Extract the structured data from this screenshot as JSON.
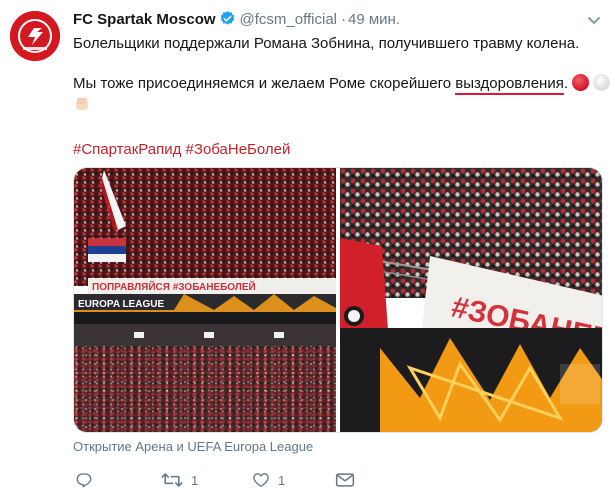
{
  "tweet": {
    "author_name": "FC Spartak Moscow",
    "handle": "@fcsm_official",
    "separator": "·",
    "time": "49 мин.",
    "verified": true,
    "text_line1": "Болельщики поддержали Романа Зобнина, получившего травму колена.",
    "text_line2_before": "Мы тоже присоединяемся и желаем Роме скорейшего ",
    "text_line2_underlined": "выздоровления",
    "text_line2_after": ".",
    "hashtags": [
      "#СпартакРапид",
      "#ЗобаНеБолей"
    ],
    "photo_banner_text": "ПОПРАВЛЯЙСЯ #ЗОБАНЕБОЛЕЙ",
    "photo_sponsor_text": "EUROPA LEAGUE",
    "photo_right_banner": "#ЗОБАНЕБОЛЕ",
    "media_caption": "Открытие Арена и UEFA Europa League",
    "reply_count": "",
    "retweet_count": "1",
    "like_count": "1"
  },
  "colors": {
    "brand_red": "#d41820",
    "hashtag": "#c4232c",
    "verified_blue": "#1da1f2",
    "muted": "#657786",
    "underline": "#e0163a"
  },
  "icons": {
    "reply": "reply-icon",
    "retweet": "retweet-icon",
    "like": "heart-icon",
    "dm": "envelope-icon",
    "menu": "chevron-down-icon"
  }
}
